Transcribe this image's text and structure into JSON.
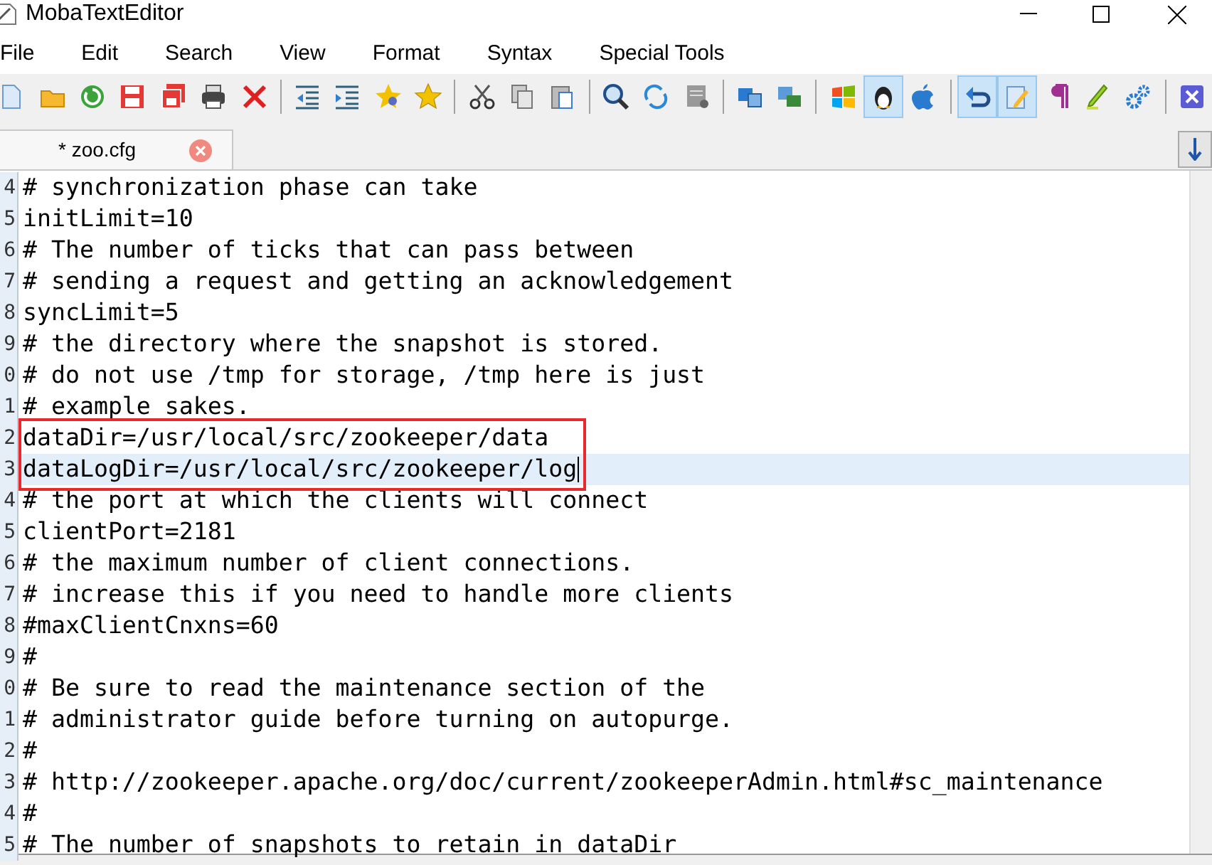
{
  "window": {
    "title": "MobaTextEditor"
  },
  "menu": [
    "File",
    "Edit",
    "Search",
    "View",
    "Format",
    "Syntax",
    "Special Tools"
  ],
  "toolbar": [
    {
      "kind": "new",
      "selected": false
    },
    {
      "kind": "open",
      "selected": false
    },
    {
      "kind": "reload",
      "selected": false
    },
    {
      "kind": "save",
      "selected": false
    },
    {
      "kind": "saveall",
      "selected": false
    },
    {
      "kind": "print",
      "selected": false
    },
    {
      "kind": "close",
      "selected": false
    },
    {
      "kind": "sep"
    },
    {
      "kind": "outdent",
      "selected": false
    },
    {
      "kind": "indent",
      "selected": false
    },
    {
      "kind": "bookmark",
      "selected": false
    },
    {
      "kind": "star",
      "selected": false
    },
    {
      "kind": "sep"
    },
    {
      "kind": "cut",
      "selected": false
    },
    {
      "kind": "copy",
      "selected": false
    },
    {
      "kind": "paste",
      "selected": false
    },
    {
      "kind": "sep"
    },
    {
      "kind": "find",
      "selected": false
    },
    {
      "kind": "replace",
      "selected": false
    },
    {
      "kind": "goto",
      "selected": false
    },
    {
      "kind": "sep"
    },
    {
      "kind": "split",
      "selected": false
    },
    {
      "kind": "merge",
      "selected": false
    },
    {
      "kind": "sep"
    },
    {
      "kind": "windows",
      "selected": false
    },
    {
      "kind": "linux",
      "selected": true
    },
    {
      "kind": "apple",
      "selected": false
    },
    {
      "kind": "sep"
    },
    {
      "kind": "undo",
      "selected": true
    },
    {
      "kind": "edit",
      "selected": true
    },
    {
      "kind": "pilcrow",
      "selected": false
    },
    {
      "kind": "highlight",
      "selected": false
    },
    {
      "kind": "gears",
      "selected": false
    },
    {
      "kind": "sep"
    },
    {
      "kind": "exit",
      "selected": false
    }
  ],
  "tabs": [
    {
      "label": "* zoo.cfg",
      "selected": true
    }
  ],
  "editor": {
    "lines": [
      {
        "number": "4",
        "text": "# synchronization phase can take",
        "current": false,
        "marked": false
      },
      {
        "number": "5",
        "text": "initLimit=10",
        "current": false,
        "marked": false
      },
      {
        "number": "6",
        "text": "# The number of ticks that can pass between",
        "current": false,
        "marked": false
      },
      {
        "number": "7",
        "text": "# sending a request and getting an acknowledgement",
        "current": false,
        "marked": false
      },
      {
        "number": "8",
        "text": "syncLimit=5",
        "current": false,
        "marked": false
      },
      {
        "number": "9",
        "text": "# the directory where the snapshot is stored.",
        "current": false,
        "marked": false
      },
      {
        "number": "0",
        "text": "# do not use /tmp for storage, /tmp here is just",
        "current": false,
        "marked": false
      },
      {
        "number": "1",
        "text": "# example sakes.",
        "current": false,
        "marked": false
      },
      {
        "number": "2",
        "text": "dataDir=/usr/local/src/zookeeper/data",
        "current": false,
        "marked": true
      },
      {
        "number": "3",
        "text": "dataLogDir=/usr/local/src/zookeeper/log",
        "current": true,
        "marked": true
      },
      {
        "number": "4",
        "text": "# the port at which the clients will connect",
        "current": false,
        "marked": false
      },
      {
        "number": "5",
        "text": "clientPort=2181",
        "current": false,
        "marked": false
      },
      {
        "number": "6",
        "text": "# the maximum number of client connections.",
        "current": false,
        "marked": false
      },
      {
        "number": "7",
        "text": "# increase this if you need to handle more clients",
        "current": false,
        "marked": false
      },
      {
        "number": "8",
        "text": "#maxClientCnxns=60",
        "current": false,
        "marked": false
      },
      {
        "number": "9",
        "text": "#",
        "current": false,
        "marked": false
      },
      {
        "number": "0",
        "text": "# Be sure to read the maintenance section of the",
        "current": false,
        "marked": false
      },
      {
        "number": "1",
        "text": "# administrator guide before turning on autopurge.",
        "current": false,
        "marked": false
      },
      {
        "number": "2",
        "text": "#",
        "current": false,
        "marked": false
      },
      {
        "number": "3",
        "text": "# http://zookeeper.apache.org/doc/current/zookeeperAdmin.html#sc_maintenance",
        "current": false,
        "marked": false
      },
      {
        "number": "4",
        "text": "#",
        "current": false,
        "marked": false
      },
      {
        "number": "5",
        "text": "# The number of snapshots to retain in dataDir",
        "current": false,
        "marked": false
      }
    ]
  }
}
